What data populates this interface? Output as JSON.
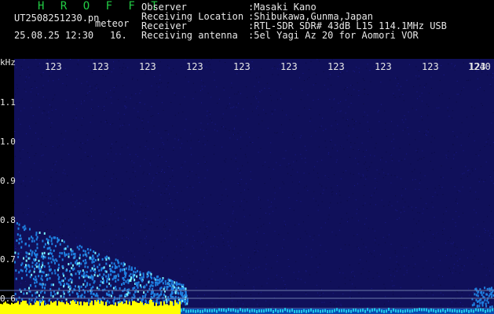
{
  "header": {
    "title": "H R O F F T",
    "filename": "UT2508251230.pn",
    "meteor_label": "meteor",
    "datetime": "25.08.25 12:30",
    "count": "16.",
    "info_rows": [
      {
        "label": "Observer",
        "value": ":Masaki Kano"
      },
      {
        "label": "Receiving Location",
        "value": ":Shibukawa,Gunma,Japan"
      },
      {
        "label": "Receiver",
        "value": ":RTL-SDR SDR# 43dB L15 114.1MHz USB"
      },
      {
        "label": "Receiving antenna",
        "value": ":5el Yagi Az 20 for Aomori VOR"
      }
    ]
  },
  "axes": {
    "unit_label": "kHz",
    "time_ticks": [
      "123",
      "123",
      "123",
      "123",
      "123",
      "123",
      "123",
      "123",
      "123",
      "123",
      "1240"
    ],
    "freq_ticks": [
      "1.1",
      "1.0",
      "0.9",
      "0.8",
      "0.7",
      "0.6"
    ]
  },
  "colors": {
    "background": "#000000",
    "noise": "#10105a",
    "signal": "#1e7fe0",
    "signal_hot": "#7af0ff",
    "band": "#ffff00",
    "text": "#e8e8e8",
    "title": "#22cc44"
  }
}
